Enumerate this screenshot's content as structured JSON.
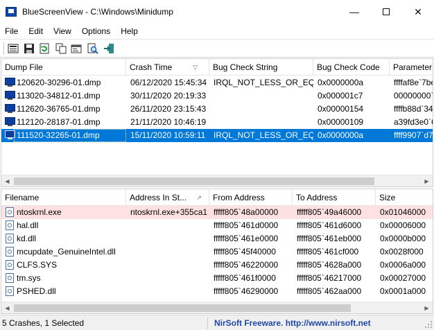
{
  "window": {
    "title": "BlueScreenView  -  C:\\Windows\\Minidump",
    "minimize": "—",
    "close": "✕"
  },
  "menu": [
    "File",
    "Edit",
    "View",
    "Options",
    "Help"
  ],
  "toolbar": [
    "save-icon",
    "floppy-icon",
    "refresh-icon",
    "copy-icon",
    "properties-icon",
    "find-icon",
    "exit-icon"
  ],
  "dumps": {
    "columns": [
      "Dump File",
      "Crash Time",
      "Bug Check String",
      "Bug Check Code",
      "Parameter"
    ],
    "sort_indicator": "▽",
    "rows": [
      [
        "120620-30296-01.dmp",
        "06/12/2020 15:45:34",
        "IRQL_NOT_LESS_OR_EQ...",
        "0x0000000a",
        "ffffaf8e`7be"
      ],
      [
        "113020-34812-01.dmp",
        "30/11/2020 20:19:33",
        "",
        "0x000001c7",
        "00000000`0"
      ],
      [
        "112620-36765-01.dmp",
        "26/11/2020 23:15:43",
        "",
        "0x00000154",
        "ffffb88d`34"
      ],
      [
        "112120-28187-01.dmp",
        "21/11/2020 10:46:19",
        "",
        "0x00000109",
        "a39fd3e0`6"
      ],
      [
        "111520-32265-01.dmp",
        "15/11/2020 10:59:11",
        "IRQL_NOT_LESS_OR_EQ...",
        "0x0000000a",
        "ffff9907`d7"
      ]
    ],
    "selected_index": 4
  },
  "drivers": {
    "columns": [
      "Filename",
      "Address In St...",
      "From Address",
      "To Address",
      "Size"
    ],
    "sort_indicator": "↗",
    "rows": [
      [
        "ntoskrnl.exe",
        "ntoskrnl.exe+355ca1",
        "fffff805`48a00000",
        "fffff805`49a46000",
        "0x01046000"
      ],
      [
        "hal.dll",
        "",
        "fffff805`461d0000",
        "fffff805`461d6000",
        "0x00006000"
      ],
      [
        "kd.dll",
        "",
        "fffff805`461e0000",
        "fffff805`461eb000",
        "0x0000b000"
      ],
      [
        "mcupdate_GenuineIntel.dll",
        "",
        "fffff805`45f40000",
        "fffff805`461cf000",
        "0x0028f000"
      ],
      [
        "CLFS.SYS",
        "",
        "fffff805`46220000",
        "fffff805`4628a000",
        "0x0006a000"
      ],
      [
        "tm.sys",
        "",
        "fffff805`461f0000",
        "fffff805`46217000",
        "0x00027000"
      ],
      [
        "PSHED.dll",
        "",
        "fffff805`46290000",
        "fffff805`462aa000",
        "0x0001a000"
      ]
    ],
    "highlighted_index": 0
  },
  "status": {
    "left": "5 Crashes, 1 Selected",
    "right": "NirSoft Freeware.  http://www.nirsoft.net"
  },
  "colors": {
    "selection": "#0078d7",
    "highlight": "#ffe1e1",
    "link": "#1f47a8"
  }
}
